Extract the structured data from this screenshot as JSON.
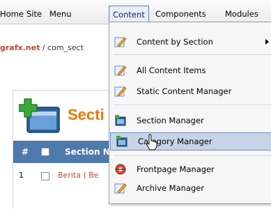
{
  "menubar": {
    "items": [
      {
        "label": "Home"
      },
      {
        "label": "Site"
      },
      {
        "label": "Menu"
      },
      {
        "label": "Content"
      },
      {
        "label": "Components"
      },
      {
        "label": "Modules"
      }
    ]
  },
  "pathbar": {
    "site": "grafx.net",
    "rest": " / com_sect"
  },
  "panel": {
    "title": "Secti",
    "table": {
      "headers": {
        "hash": "#",
        "name": "Section N"
      },
      "rows": [
        {
          "num": "1",
          "name": "Berita ( Be"
        }
      ]
    }
  },
  "dropdown": {
    "items": [
      {
        "label": "Content by Section",
        "icon": "pencil-edit-icon",
        "submenu": true
      },
      {
        "label": "All Content Items",
        "icon": "pencil-edit-icon"
      },
      {
        "label": "Static Content Manager",
        "icon": "pencil-edit-icon"
      },
      {
        "label": "Section Manager",
        "icon": "section-box-icon"
      },
      {
        "label": "Category Manager",
        "icon": "section-box-icon",
        "highlighted": true
      },
      {
        "label": "Frontpage Manager",
        "icon": "frontpage-icon"
      },
      {
        "label": "Archive Manager",
        "icon": "pencil-edit-icon"
      }
    ]
  },
  "colors": {
    "accent": "#4f79ad",
    "highlight": "#c8d4e6",
    "link": "#c64934",
    "title": "#f07800"
  }
}
